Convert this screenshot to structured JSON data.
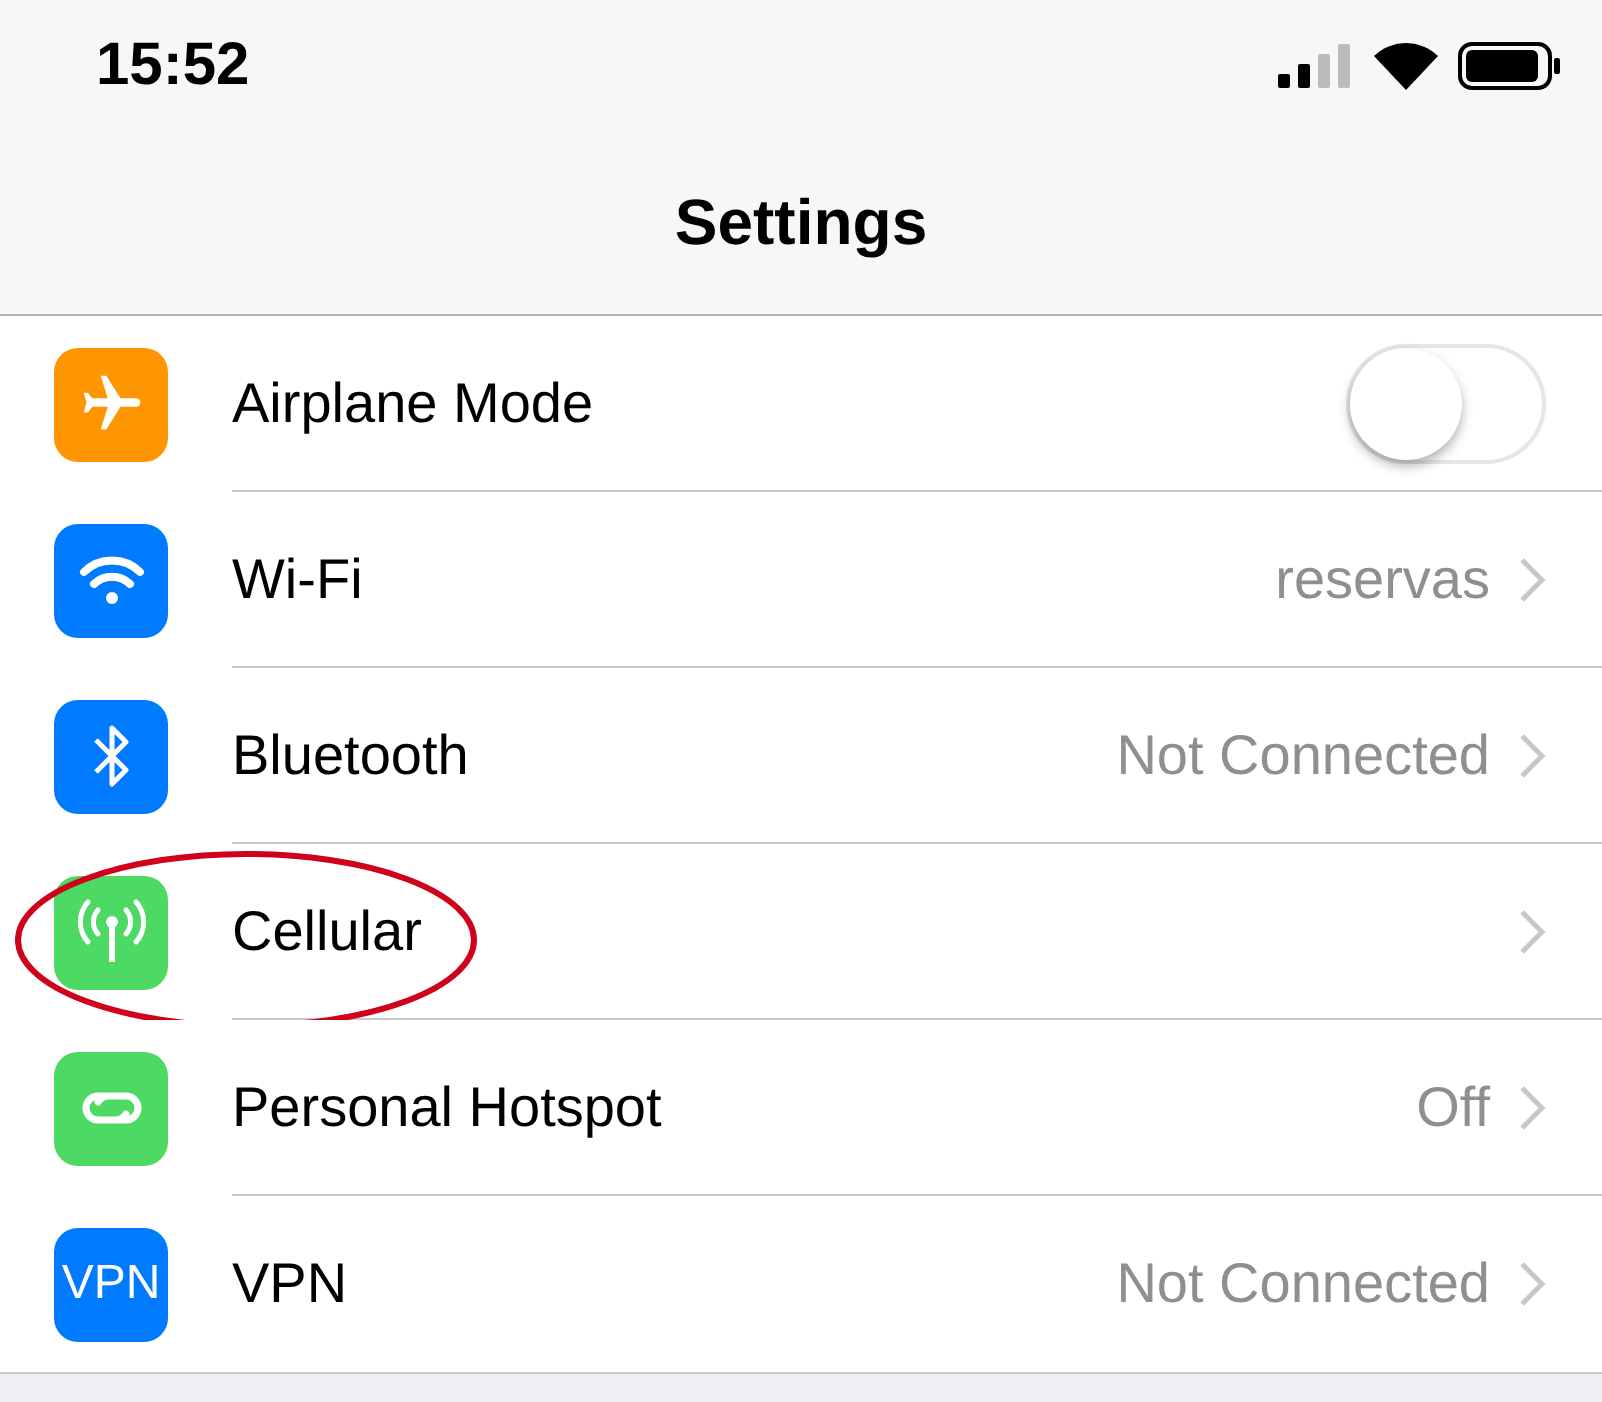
{
  "status_bar": {
    "time": "15:52"
  },
  "title": "Settings",
  "rows": [
    {
      "kind": "toggle",
      "label": "Airplane Mode",
      "color": "#ff9500",
      "on": false,
      "highlighted": false
    },
    {
      "kind": "detail",
      "label": "Wi-Fi",
      "color": "#007aff",
      "value": "reservas",
      "highlighted": false
    },
    {
      "kind": "detail",
      "label": "Bluetooth",
      "color": "#007aff",
      "value": "Not Connected",
      "highlighted": false
    },
    {
      "kind": "detail",
      "label": "Cellular",
      "color": "#4cd964",
      "highlighted": true
    },
    {
      "kind": "detail",
      "label": "Personal Hotspot",
      "color": "#4cd964",
      "value": "Off",
      "highlighted": false
    },
    {
      "kind": "detail",
      "label": "VPN",
      "color": "#007aff",
      "icon_text": "VPN",
      "value": "Not Connected",
      "highlighted": false
    }
  ]
}
